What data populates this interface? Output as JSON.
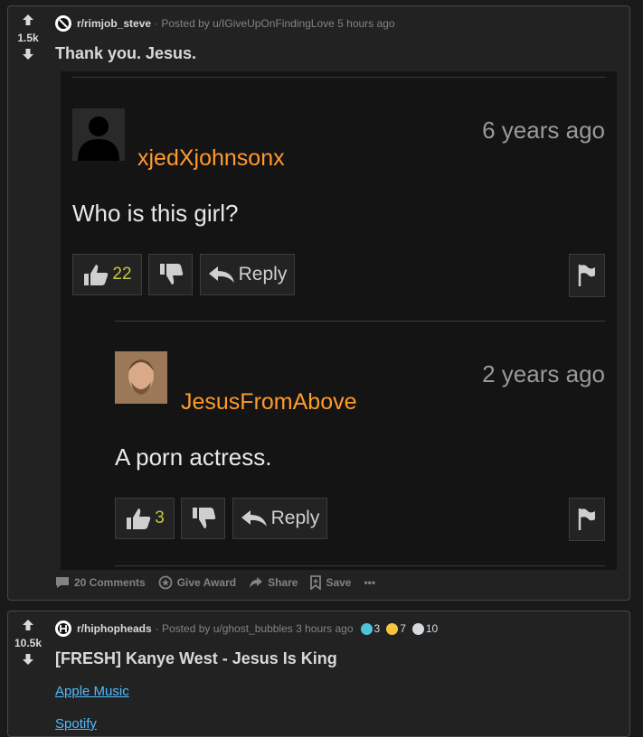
{
  "post1": {
    "score": "1.5k",
    "subreddit": "r/rimjob_steve",
    "posted_by": "· Posted by u/IGiveUpOnFindingLove 5 hours ago",
    "title": "Thank you. Jesus.",
    "embed": {
      "comment1": {
        "username": "xjedXjohnsonx",
        "time": "6 years ago",
        "text": "Who is this girl?",
        "likes": "22",
        "reply": "Reply"
      },
      "comment2": {
        "username": "JesusFromAbove",
        "time": "2 years ago",
        "text": "A porn actress.",
        "likes": "3",
        "reply": "Reply"
      }
    },
    "actions": {
      "comments": "20 Comments",
      "award": "Give Award",
      "share": "Share",
      "save": "Save",
      "more": "•••"
    }
  },
  "post2": {
    "score": "10.5k",
    "subreddit": "r/hiphopheads",
    "posted_by": "· Posted by u/ghost_bubbles 3 hours ago",
    "awards": [
      "3",
      "7",
      "10"
    ],
    "title": "[FRESH] Kanye West - Jesus Is King",
    "links": [
      "Apple Music",
      "Spotify"
    ]
  }
}
